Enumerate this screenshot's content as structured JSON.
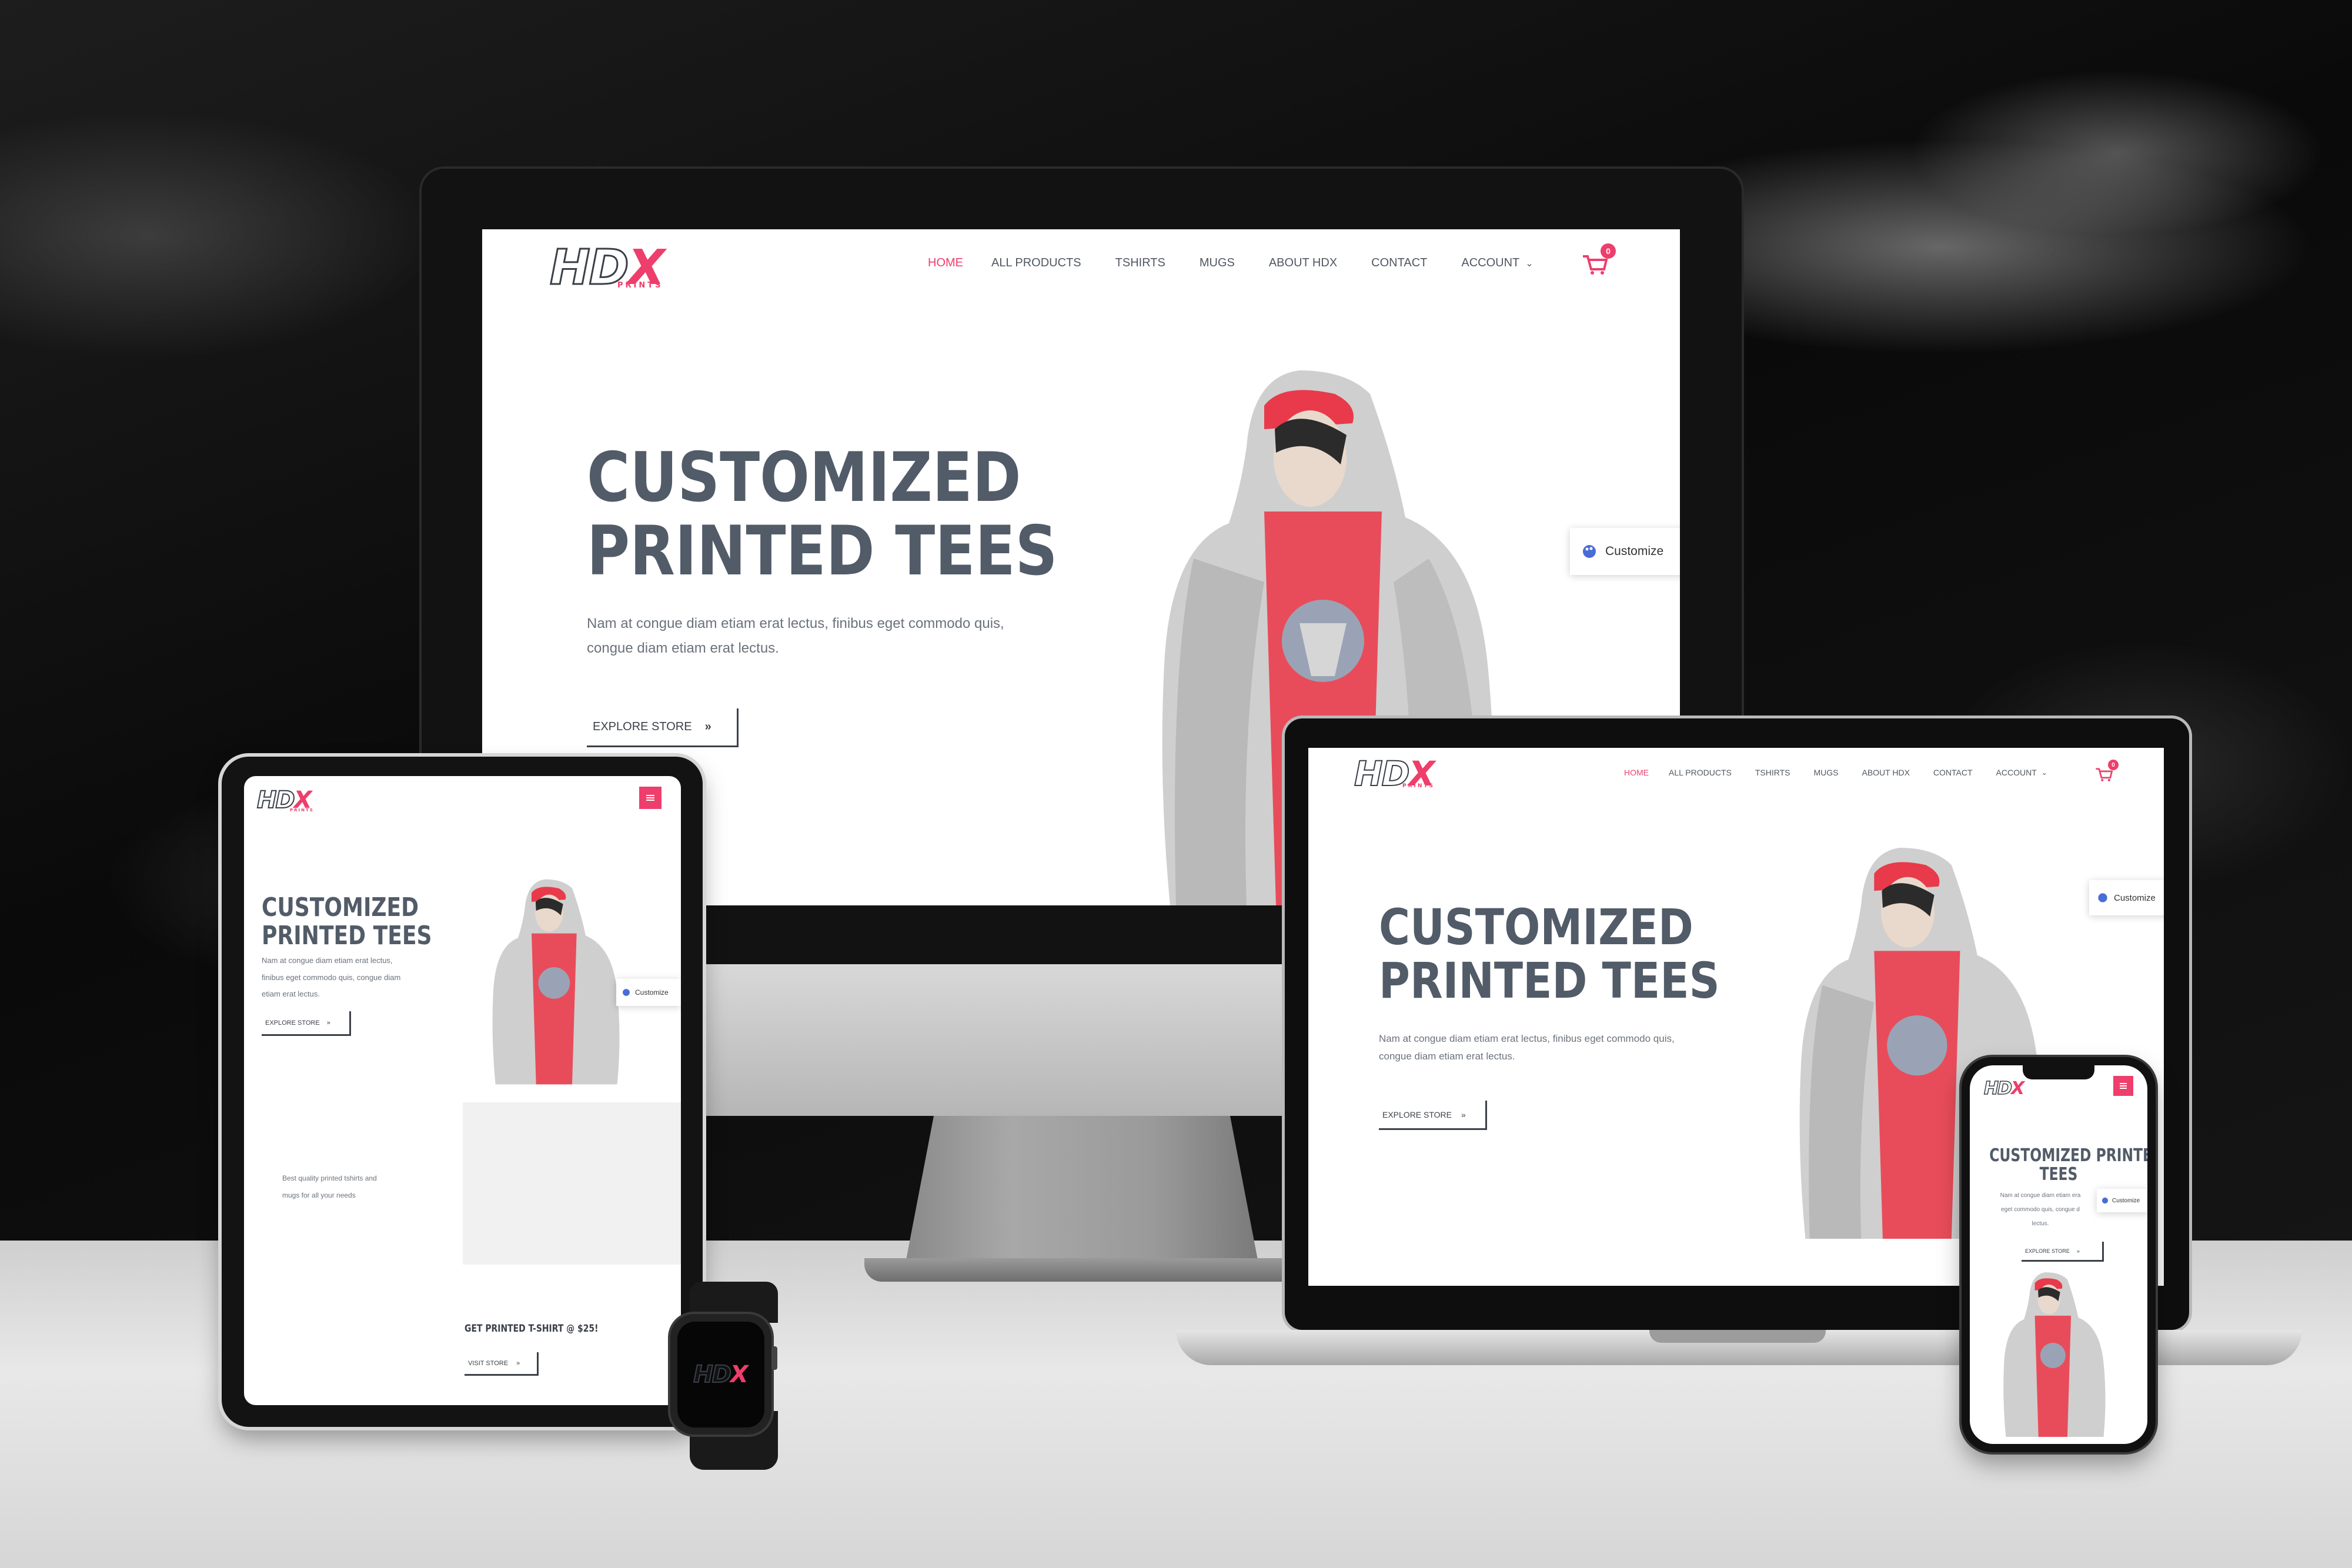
{
  "brand": {
    "logo_main": "HD",
    "logo_x": "X",
    "logo_sub": "PRINTS"
  },
  "nav": {
    "items": [
      "HOME",
      "ALL PRODUCTS",
      "TSHIRTS",
      "MUGS",
      "ABOUT HDX",
      "CONTACT",
      "ACCOUNT"
    ],
    "cart_count": "0"
  },
  "hero": {
    "title_line1": "CUSTOMIZED",
    "title_line2": "PRINTED TEES",
    "mobile_title_line1": "CUSTOMIZED PRINTED",
    "mobile_title_line2": "TEES",
    "text_line1": "Nam at congue diam etiam erat lectus, finibus eget commodo quis,",
    "text_line2": "congue diam etiam erat lectus.",
    "tablet_text_line1": "Nam at congue diam etiam erat lectus,",
    "tablet_text_line2": "finibus eget commodo quis, congue diam",
    "tablet_text_line3": "etiam erat lectus.",
    "phone_text_line1": "Nam at congue diam etiam era",
    "phone_text_line2": "eget commodo quis, congue d",
    "phone_text_line3": "lectus.",
    "button": "EXPLORE STORE",
    "button_arrow": "»"
  },
  "customize": {
    "label": "Customize"
  },
  "tablet_extra": {
    "tagline_line1": "Best quality printed tshirts and",
    "tagline_line2": "mugs for all your needs",
    "promo_title": "GET PRINTED T-SHIRT @ $25!",
    "promo_button": "VISIT STORE"
  },
  "icons": {
    "cart": "cart-icon",
    "chevron": "chevron-down-icon",
    "palette": "palette-icon",
    "menu": "hamburger-menu-icon"
  },
  "colors": {
    "accent": "#ee3e6b",
    "heading": "#525b68",
    "text": "#6b727c"
  }
}
